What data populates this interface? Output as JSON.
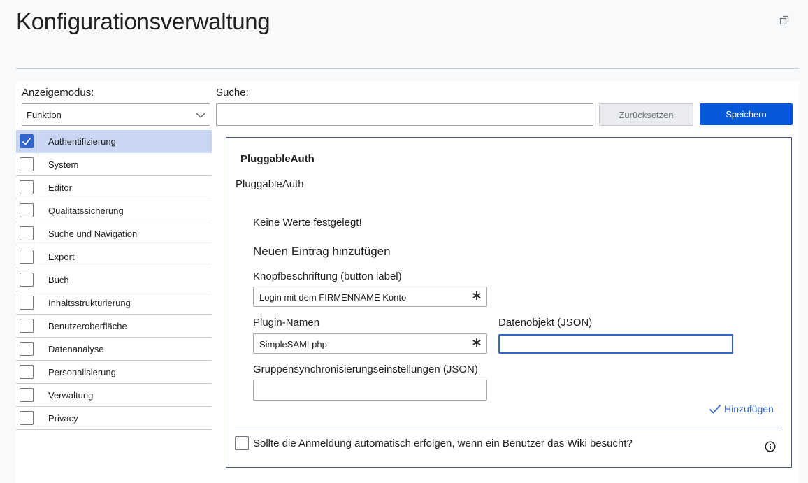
{
  "page": {
    "title": "Konfigurationsverwaltung"
  },
  "toolbar": {
    "view_mode_label": "Anzeigemodus:",
    "view_mode_value": "Funktion",
    "search_label": "Suche:",
    "search_value": "",
    "reset_label": "Zurücksetzen",
    "save_label": "Speichern"
  },
  "sidebar": {
    "items": [
      {
        "label": "Authentifizierung",
        "checked": true
      },
      {
        "label": "System",
        "checked": false
      },
      {
        "label": "Editor",
        "checked": false
      },
      {
        "label": "Qualitätssicherung",
        "checked": false
      },
      {
        "label": "Suche und Navigation",
        "checked": false
      },
      {
        "label": "Export",
        "checked": false
      },
      {
        "label": "Buch",
        "checked": false
      },
      {
        "label": "Inhaltsstrukturierung",
        "checked": false
      },
      {
        "label": "Benutzeroberfläche",
        "checked": false
      },
      {
        "label": "Datenanalyse",
        "checked": false
      },
      {
        "label": "Personalisierung",
        "checked": false
      },
      {
        "label": "Verwaltung",
        "checked": false
      },
      {
        "label": "Privacy",
        "checked": false
      }
    ]
  },
  "content": {
    "section_title": "PluggableAuth",
    "section_subtitle": "PluggableAuth",
    "no_values": "Keine Werte festgelegt!",
    "add_entry_title": "Neuen Eintrag hinzufügen",
    "button_label_label": "Knopfbeschriftung (button label)",
    "button_label_value": "Login mit dem FIRMENNAME Konto",
    "plugin_name_label": "Plugin-Namen",
    "plugin_name_value": "SimpleSAMLphp",
    "data_object_label": "Datenobjekt (JSON)",
    "data_object_value": "",
    "group_sync_label": "Gruppensynchronisierungseinstellungen (JSON)",
    "group_sync_value": "",
    "add_link_label": "Hinzufügen",
    "auto_login_label": "Sollte die Anmeldung automatisch erfolgen, wenn ein Benutzer das Wiki besucht?",
    "auto_login_checked": false
  },
  "colors": {
    "primary": "#0659d8",
    "selected_bg": "#c8d6f4",
    "link": "#3366cc"
  }
}
